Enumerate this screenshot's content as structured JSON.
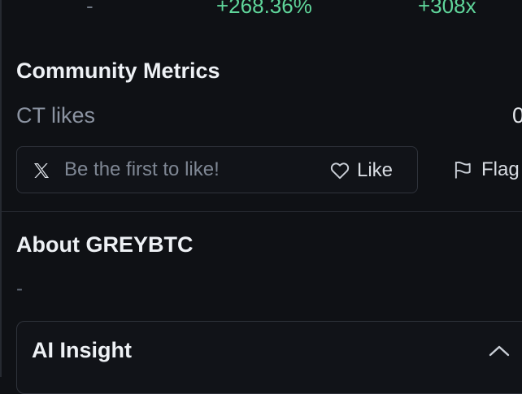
{
  "stats": {
    "dash": "-",
    "percent_change": "+268.36%",
    "multiplier": "+308x"
  },
  "community": {
    "title": "Community Metrics",
    "ct_likes_label": "CT likes",
    "ct_likes_count": "0",
    "like_prompt": "Be the first to like!",
    "like_label": "Like",
    "flag_label": "Flag"
  },
  "about": {
    "title": "About GREYBTC",
    "description": "-"
  },
  "ai_insight": {
    "title": "AI Insight"
  },
  "colors": {
    "background": "#0f1115",
    "positive": "#5fd59a",
    "muted": "#8b93a1"
  },
  "icons": {
    "x": "x-logo-icon",
    "like": "heart-icon",
    "flag": "flag-icon",
    "collapse": "chevron-up-icon"
  }
}
